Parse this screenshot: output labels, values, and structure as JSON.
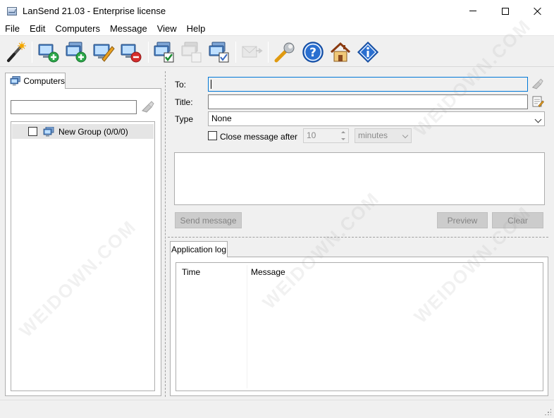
{
  "window": {
    "title": "LanSend 21.03 - Enterprise license"
  },
  "menu": [
    "File",
    "Edit",
    "Computers",
    "Message",
    "View",
    "Help"
  ],
  "toolbar": {
    "buttons": [
      {
        "name": "wizard-icon",
        "enabled": true
      },
      {
        "name": "add-computer-icon",
        "enabled": true
      },
      {
        "name": "add-group-icon",
        "enabled": true
      },
      {
        "name": "edit-computer-icon",
        "enabled": true
      },
      {
        "name": "remove-computer-icon",
        "enabled": true
      },
      {
        "name": "check-all-icon",
        "enabled": true
      },
      {
        "name": "uncheck-all-icon",
        "enabled": false
      },
      {
        "name": "select-computers-icon",
        "enabled": true
      },
      {
        "name": "send-message-icon",
        "enabled": false
      },
      {
        "name": "settings-wrench-icon",
        "enabled": true
      },
      {
        "name": "help-icon",
        "enabled": true
      },
      {
        "name": "home-icon",
        "enabled": true
      },
      {
        "name": "about-icon",
        "enabled": true
      }
    ]
  },
  "left": {
    "tab_label": "Computers",
    "filter_value": "",
    "tree": [
      {
        "label": "New Group (0/0/0)",
        "checked": false
      }
    ]
  },
  "form": {
    "to_label": "To:",
    "to_value": "",
    "title_label": "Title:",
    "title_value": "",
    "type_label": "Type",
    "type_value": "None",
    "close_after_label": "Close message after",
    "close_after_checked": false,
    "close_after_value": "10",
    "close_after_unit": "minutes",
    "message_value": ""
  },
  "buttons": {
    "send": "Send message",
    "preview": "Preview",
    "clear": "Clear"
  },
  "log": {
    "tab_label": "Application log",
    "columns": [
      "Time",
      "Message"
    ],
    "rows": []
  },
  "watermark": "WEIDOWN.COM",
  "colors": {
    "accent": "#0078d7",
    "disabled_button": "#cccccc"
  }
}
